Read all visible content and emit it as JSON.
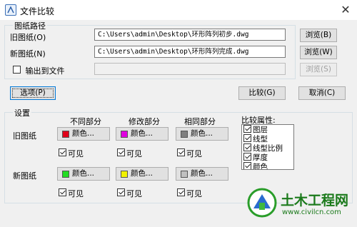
{
  "window": {
    "title": "文件比较",
    "close_glyph": "✕"
  },
  "paths": {
    "group_title": "图纸路径",
    "old_label": "旧图纸(O)",
    "old_value": "C:\\Users\\admin\\Desktop\\环形阵列初步.dwg",
    "old_browse": "浏览(B)",
    "new_label": "新图纸(N)",
    "new_value": "C:\\Users\\admin\\Desktop\\环形阵列完成.dwg",
    "new_browse": "浏览(W)",
    "output_label": "输出到文件",
    "output_value": "",
    "output_browse": "浏览(S)"
  },
  "buttons": {
    "options": "选项(P)",
    "compare": "比较(G)",
    "cancel": "取消(C)"
  },
  "settings": {
    "group_title": "设置",
    "col_diff": "不同部分",
    "col_modified": "修改部分",
    "col_same": "相同部分",
    "row_old": "旧图纸",
    "row_new": "新图纸",
    "color_label": "颜色...",
    "visible_label": "可见",
    "old_colors": {
      "diff": "#e0001a",
      "modified": "#e000e0",
      "same": "#7f7f7f"
    },
    "new_colors": {
      "diff": "#22dd22",
      "modified": "#f2f200",
      "same": "#c0c0c0"
    }
  },
  "properties": {
    "title": "比较属性:",
    "items": [
      "图层",
      "线型",
      "线型比例",
      "厚度",
      "颜色"
    ]
  },
  "watermark": {
    "name": "土木工程网",
    "url": "www.civilcn.com"
  }
}
